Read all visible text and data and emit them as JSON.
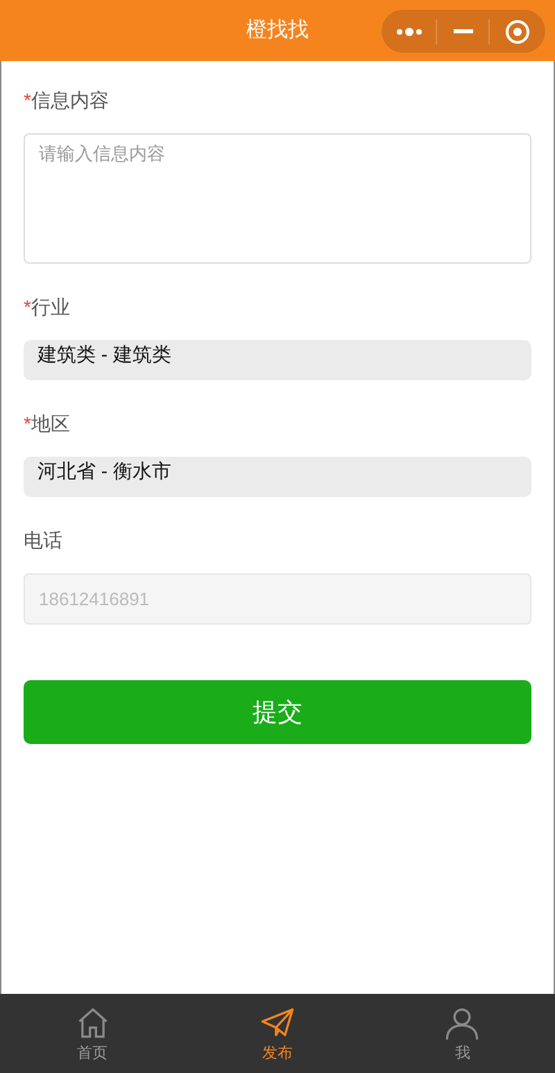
{
  "nav_bar": {
    "title": "橙找找"
  },
  "form": [
    {
      "kind": "textarea",
      "label": "信息内容",
      "required_mark": "*",
      "placeholder": "请输入信息内容"
    },
    {
      "kind": "picker",
      "label": "行业",
      "required_mark": "*",
      "value": "建筑类 - 建筑类"
    },
    {
      "kind": "picker",
      "label": "地区",
      "required_mark": "*",
      "value": "河北省 - 衡水市"
    },
    {
      "kind": "input",
      "label": "电话",
      "placeholder": "18612416891",
      "disabled": true
    }
  ],
  "submit_button": "提交",
  "tab_bar": [
    {
      "label": "首页",
      "selected": false
    },
    {
      "label": "发布",
      "selected": true
    },
    {
      "label": "我",
      "selected": false
    }
  ]
}
